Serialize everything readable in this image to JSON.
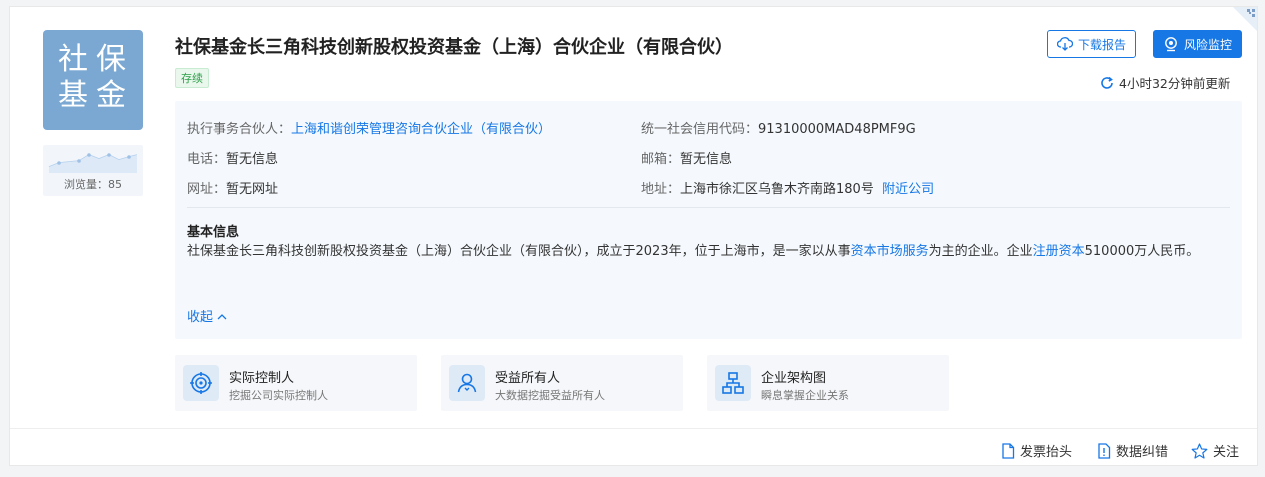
{
  "company": {
    "logo_lines": [
      "社保",
      "基金"
    ],
    "name": "社保基金长三角科技创新股权投资基金（上海）合伙企业（有限合伙）",
    "status": "存续",
    "views_label": "浏览量：85"
  },
  "actions": {
    "download_report": "下载报告",
    "risk_monitor": "风险监控",
    "updated": "4小时32分钟前更新"
  },
  "info": {
    "partner_label": "执行事务合伙人：",
    "partner_value": "上海和谐创荣管理咨询合伙企业（有限合伙）",
    "credit_label": "统一社会信用代码：",
    "credit_value": "91310000MAD48PMF9G",
    "phone_label": "电话：",
    "phone_value": "暂无信息",
    "email_label": "邮箱：",
    "email_value": "暂无信息",
    "website_label": "网址：",
    "website_value": "暂无网址",
    "address_label": "地址：",
    "address_value": "上海市徐汇区乌鲁木齐南路180号",
    "nearby_link": "附近公司",
    "basic_title": "基本信息",
    "basic_text_1": "社保基金长三角科技创新股权投资基金（上海）合伙企业（有限合伙），成立于2023年，位于上海市，是一家以从事",
    "basic_link_1": "资本市场服务",
    "basic_text_2": "为主的企业。企业",
    "basic_link_2": "注册资本",
    "basic_text_3": "510000万人民币。",
    "collapse": "收起"
  },
  "features": [
    {
      "name": "实际控制人",
      "desc": "挖掘公司实际控制人",
      "icon": "target-icon"
    },
    {
      "name": "受益所有人",
      "desc": "大数据挖掘受益所有人",
      "icon": "person-icon"
    },
    {
      "name": "企业架构图",
      "desc": "瞬息掌握企业关系",
      "icon": "org-chart-icon"
    }
  ],
  "footer": {
    "invoice": "发票抬头",
    "correction": "数据纠错",
    "follow": "关注"
  },
  "colors": {
    "accent": "#1677e5",
    "logo_bg": "#7aa8d2",
    "status": "#2fa04a"
  }
}
